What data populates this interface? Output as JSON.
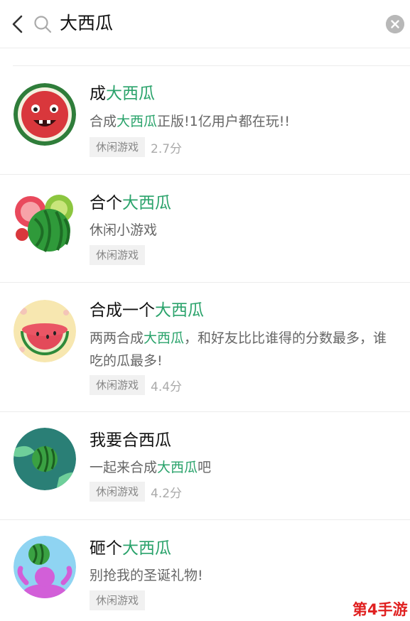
{
  "search": {
    "query": "大西瓜"
  },
  "results": [
    {
      "title_pre": "成",
      "title_hl": "大西瓜",
      "title_post": "",
      "desc_pre": "合成",
      "desc_hl": "大西瓜",
      "desc_post": "正版!1亿用户都在玩!!",
      "tag": "休闲游戏",
      "rating": "2.7分",
      "icon": "watermelon-face-icon"
    },
    {
      "title_pre": "合个",
      "title_hl": "大西瓜",
      "title_post": "",
      "desc_pre": "休闲小游戏",
      "desc_hl": "",
      "desc_post": "",
      "tag": "休闲游戏",
      "rating": "",
      "icon": "fruits-icon"
    },
    {
      "title_pre": "合成一个",
      "title_hl": "大西瓜",
      "title_post": "",
      "desc_pre": "两两合成",
      "desc_hl": "大西瓜",
      "desc_post": "，和好友比比谁得的分数最多，谁吃的瓜最多!",
      "tag": "休闲游戏",
      "rating": "4.4分",
      "icon": "watermelon-slice-icon"
    },
    {
      "title_pre": "我要合西瓜",
      "title_hl": "",
      "title_post": "",
      "desc_pre": "一起来合成",
      "desc_hl": "大西瓜",
      "desc_post": "吧",
      "tag": "休闲游戏",
      "rating": "4.2分",
      "icon": "watermelon-green-icon"
    },
    {
      "title_pre": "砸个",
      "title_hl": "大西瓜",
      "title_post": "",
      "desc_pre": "别抢我的圣诞礼物!",
      "desc_hl": "",
      "desc_post": "",
      "tag": "休闲游戏",
      "rating": "",
      "icon": "character-watermelon-icon"
    }
  ],
  "watermark": "第4手游",
  "colors": {
    "highlight": "#2aa36b",
    "tag_bg": "#f1f1f1"
  }
}
